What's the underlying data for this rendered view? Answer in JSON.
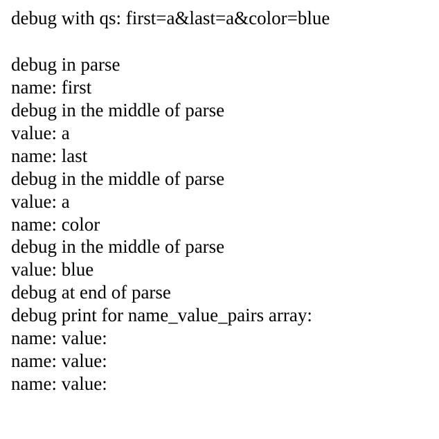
{
  "lines": [
    "debug with qs: first=a&last=a&color=blue",
    "",
    "debug in parse",
    "name: first",
    "debug in the middle of parse",
    "value: a",
    "name: last",
    "debug in the middle of parse",
    "value: a",
    "name: color",
    "debug in the middle of parse",
    "value: blue",
    "debug at end of parse",
    "debug print for name_value_pairs array:",
    "name: value:",
    "name: value:",
    "name: value:"
  ]
}
